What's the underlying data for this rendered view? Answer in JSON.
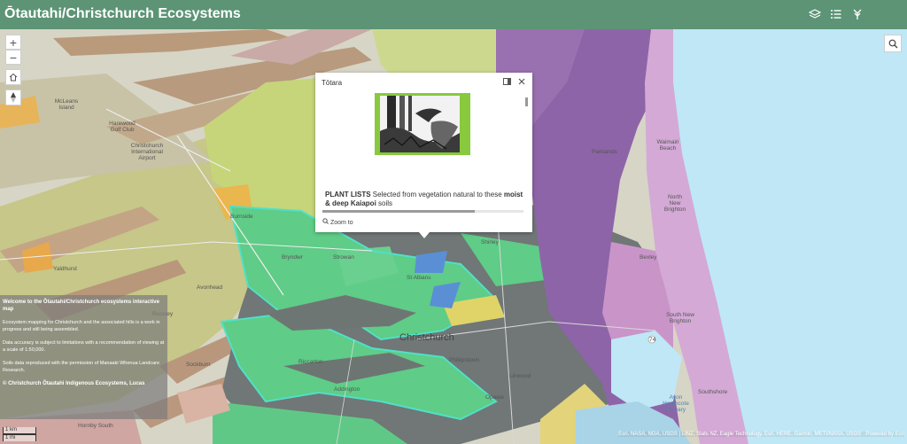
{
  "header": {
    "title": "Ōtautahi/Christchurch Ecosystems",
    "icons": [
      "layers-icon",
      "legend-list-icon",
      "basemap-gallery-icon"
    ]
  },
  "map_controls": {
    "zoom_in": "+",
    "zoom_out": "−",
    "home_icon": "home-icon",
    "compass_icon": "compass-icon",
    "search_icon": "search-icon"
  },
  "popup": {
    "title": "Tōtara",
    "body_bold_1": "PLANT LISTS",
    "body_text_1": " Selected from vegetation natural to these ",
    "body_bold_2": "moist & deep Kaiapoi",
    "body_text_2": " soils",
    "zoom_to": "Zoom to",
    "image_frame_color": "#88c93d"
  },
  "info_panel": {
    "heading": "Welcome to the Ōtautahi/Christchurch ecosystems interactive map",
    "p1": "Ecosystem mapping for Christchurch and the associated hills is a work in progress and still being assembled.",
    "p2": "Data accuracy is subject to limitations with a recommendation of viewing at a scale of 1:50,000.",
    "p3": "Soils data reproduced with the permission of Manaaki Whenua Landcare Research.",
    "p4": "© Christchurch Ōtautahi Indigenous Ecosystems, Lucas"
  },
  "scale": {
    "km": "1 km",
    "mi": "1 mi"
  },
  "attribution": "Esri, NASA, NGA, USGS | LINZ, Stats NZ, Eagle Technology, Esri, HERE, Garmin, METI/NASA, USGS",
  "powered_by": "Powered by Esri",
  "place_labels": {
    "christchurch": "Christchurch",
    "riccarton": "Riccarton",
    "addington": "Addington",
    "sockburn": "Sockburn",
    "avonhead": "Avonhead",
    "bryndwr": "Bryndwr",
    "burnside": "Burnside",
    "strowan": "Strowan",
    "st_albans": "St Albans",
    "shirley": "Shirley",
    "linwood": "Linwood",
    "phillipstown": "Phillipstown",
    "opawa": "Opawa",
    "parklands": "Parklands",
    "north_new_brighton": "North New Brighton",
    "south_new_brighton": "South New Brighton",
    "waimairi_beach": "Waimairi Beach",
    "bexley": "Bexley",
    "southshore": "Southshore",
    "russley": "Russley",
    "yaldhurst": "Yaldhurst",
    "hornby": "Hornby South",
    "avon_heathcote": "Avon Heathcote Estuary",
    "mcleans_island": "McLeans Island",
    "harewood": "Harewood Golf Club",
    "airport": "Christchurch International Airport",
    "road_74": "74"
  }
}
